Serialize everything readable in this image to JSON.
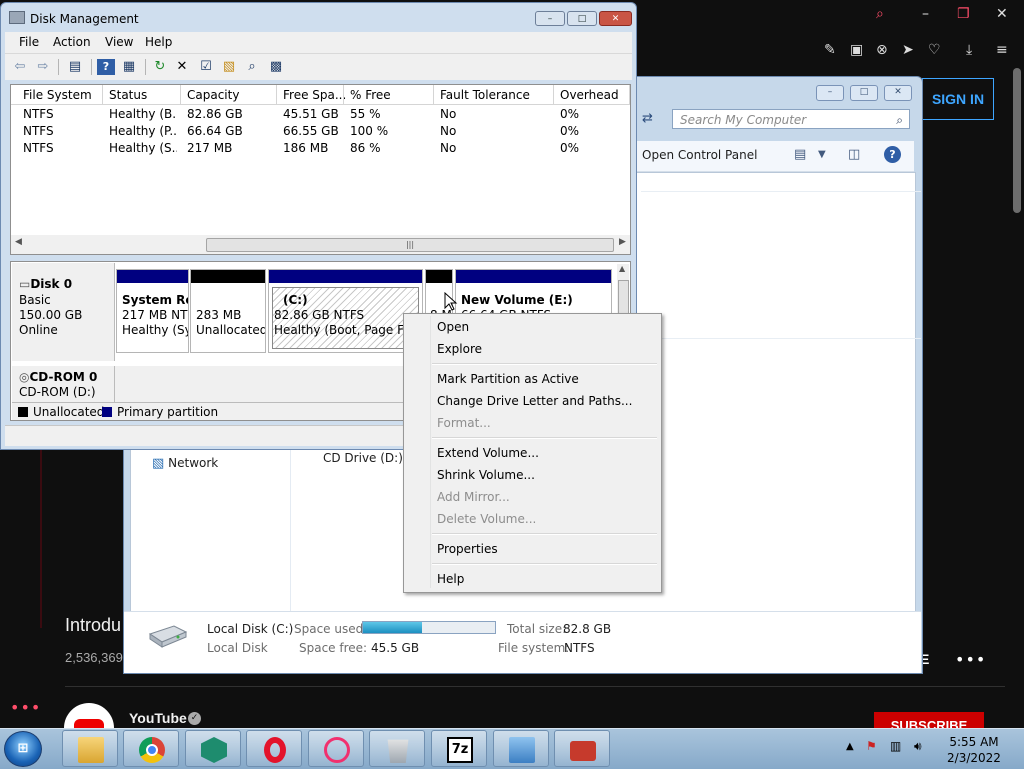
{
  "youtube": {
    "sign_in": "SIGN IN",
    "video_title": "Introdu",
    "views": "2,536,369",
    "channel": "YouTube",
    "subscribe": "SUBSCRIBE",
    "more_label": "E"
  },
  "explorer": {
    "search_placeholder": "Search My Computer",
    "open_control_panel": "Open Control Panel",
    "network": "Network",
    "cd_drive": "CD Drive (D:)",
    "details": {
      "name": "Local Disk (C:)",
      "type": "Local Disk",
      "space_used_label": "Space used:",
      "space_used_fraction": 0.45,
      "space_free_label": "Space free:",
      "space_free_value": "45.5 GB",
      "total_size_label": "Total size:",
      "total_size_value": "82.8 GB",
      "file_system_label": "File system:",
      "file_system_value": "NTFS"
    }
  },
  "disk_management": {
    "title": "Disk Management",
    "menu": [
      "File",
      "Action",
      "View",
      "Help"
    ],
    "columns": [
      "File System",
      "Status",
      "Capacity",
      "Free Spa...",
      "% Free",
      "Fault Tolerance",
      "Overhead"
    ],
    "rows": [
      [
        "NTFS",
        "Healthy (B...",
        "82.86 GB",
        "45.51 GB",
        "55 %",
        "No",
        "0%"
      ],
      [
        "NTFS",
        "Healthy (P...",
        "66.64 GB",
        "66.55 GB",
        "100 %",
        "No",
        "0%"
      ],
      [
        "NTFS",
        "Healthy (S...",
        "217 MB",
        "186 MB",
        "86 %",
        "No",
        "0%"
      ]
    ],
    "disk0": {
      "name": "Disk 0",
      "type": "Basic",
      "size": "150.00 GB",
      "state": "Online",
      "partitions": [
        {
          "line1": "System Re",
          "line2": "217 MB NT",
          "line3": "Healthy (Sy"
        },
        {
          "line1": "",
          "line2": "283 MB",
          "line3": "Unallocated"
        },
        {
          "line1": "(C:)",
          "line2": "82.86 GB NTFS",
          "line3": "Healthy (Boot, Page File,"
        },
        {
          "line1": "",
          "line2": "8 M",
          "line3": ""
        },
        {
          "line1": "New Volume  (E:)",
          "line2": "66.64 GB NTFS",
          "line3": ""
        }
      ]
    },
    "cdrom": {
      "name": "CD-ROM 0",
      "sub": "CD-ROM (D:)"
    },
    "legend": {
      "unallocated": "Unallocated",
      "primary": "Primary partition"
    },
    "colors": {
      "primary": "#000080",
      "unallocated": "#000000"
    }
  },
  "context_menu": {
    "items": [
      {
        "label": "Open",
        "enabled": true
      },
      {
        "label": "Explore",
        "enabled": true
      },
      {
        "label": "Mark Partition as Active",
        "enabled": true
      },
      {
        "label": "Change Drive Letter and Paths...",
        "enabled": true
      },
      {
        "label": "Format...",
        "enabled": false
      },
      {
        "label": "Extend Volume...",
        "enabled": true
      },
      {
        "label": "Shrink Volume...",
        "enabled": true
      },
      {
        "label": "Add Mirror...",
        "enabled": false
      },
      {
        "label": "Delete Volume...",
        "enabled": false
      },
      {
        "label": "Properties",
        "enabled": true
      },
      {
        "label": "Help",
        "enabled": true
      }
    ]
  },
  "taskbar": {
    "apps": [
      "explorer-icon",
      "chrome-icon",
      "app-shield-icon",
      "opera-icon",
      "opera-gx-icon",
      "recycle-icon",
      "7zip-icon",
      "control-panel-icon",
      "toolbox-icon"
    ],
    "sevenzip_label": "7z",
    "time": "5:55 AM",
    "date": "2/3/2022"
  }
}
